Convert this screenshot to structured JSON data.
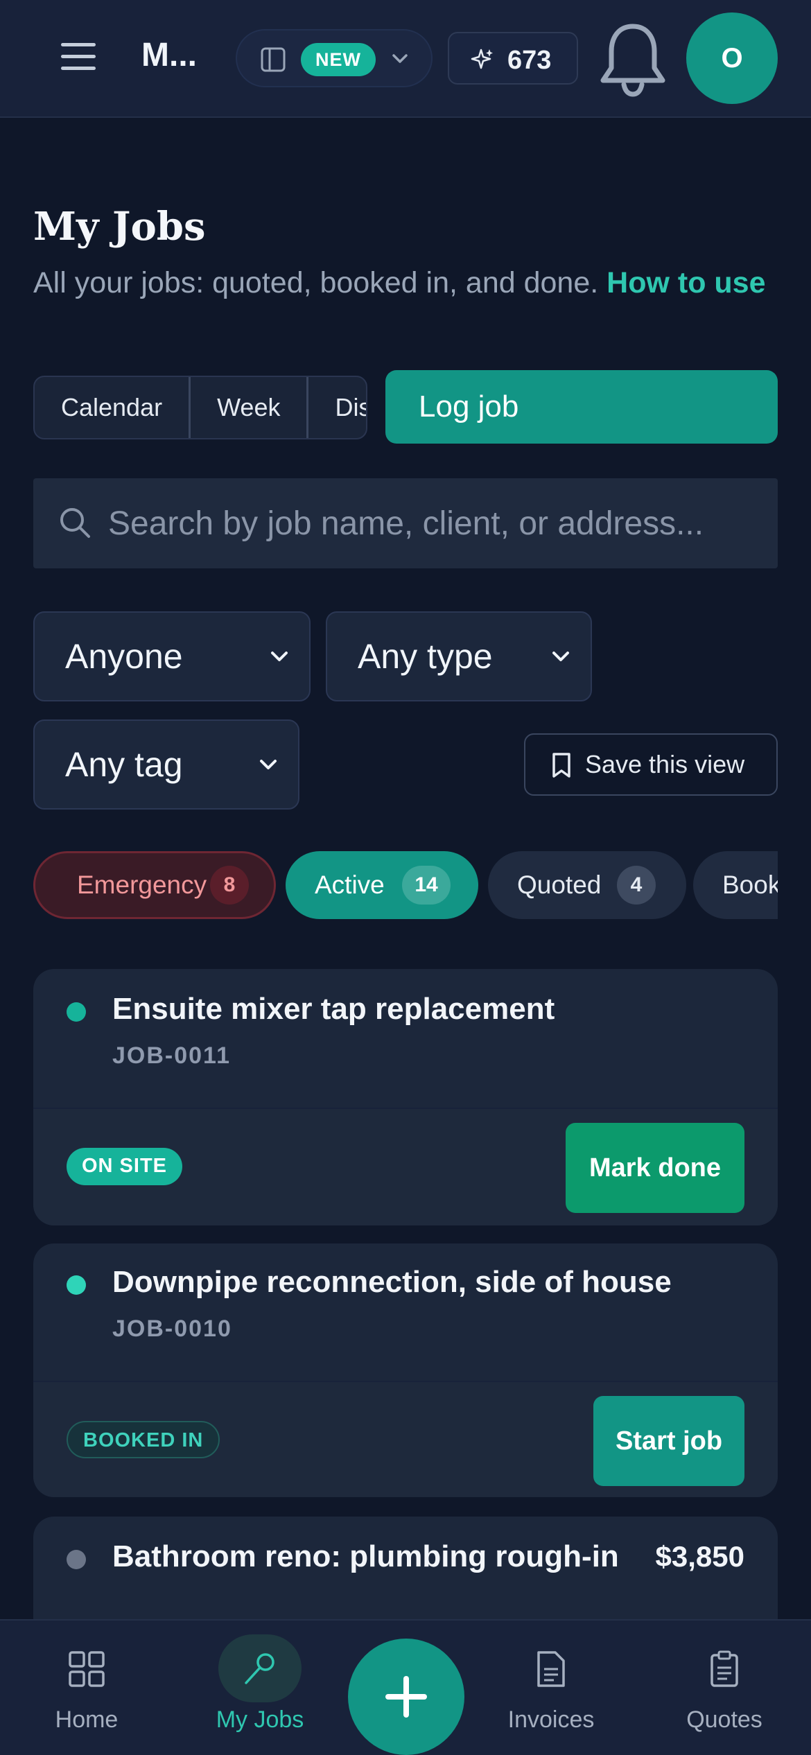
{
  "topbar": {
    "brand": "M...",
    "new_badge": "NEW",
    "credits": "673",
    "avatar_initial": "O"
  },
  "page": {
    "title": "My Jobs",
    "subtitle": "All your jobs: quoted, booked in, and done.",
    "how_to_link": "How to use"
  },
  "views": {
    "calendar": "Calendar",
    "week": "Week",
    "dispatch": "Dispatch",
    "log_job": "Log job"
  },
  "search": {
    "placeholder": "Search by job name, client, or address..."
  },
  "filters": {
    "assignee": "Anyone",
    "type": "Any type",
    "tag": "Any tag",
    "save_view": "Save this view"
  },
  "status_chips": [
    {
      "label": "Emergency",
      "count": "8"
    },
    {
      "label": "Active",
      "count": "14"
    },
    {
      "label": "Quoted",
      "count": "4"
    },
    {
      "label": "Booked in",
      "count": ""
    }
  ],
  "jobs": [
    {
      "title": "Ensuite mixer tap replacement",
      "code": "JOB-0011",
      "status": "ON SITE",
      "action": "Mark done",
      "dot_color": "#16b39a"
    },
    {
      "title": "Downpipe reconnection, side of house",
      "code": "JOB-0010",
      "status": "BOOKED IN",
      "action": "Start job",
      "dot_color": "#2fd4b8"
    },
    {
      "title": "Bathroom reno: plumbing rough-in",
      "price": "$3,850",
      "dot_color": "#6b7588"
    }
  ],
  "bottom_nav": {
    "home": "Home",
    "my_jobs": "My Jobs",
    "invoices": "Invoices",
    "quotes": "Quotes"
  },
  "colors": {
    "background": "#0f1729",
    "accent": "#129585",
    "emergency": "#f2989a",
    "done_green": "#0c9a6c"
  },
  "icons": {
    "menu": "hamburger-icon",
    "sidebar": "sidebar-panel-icon",
    "credits": "sparkle-icon",
    "notifications": "bell-icon",
    "search": "search-icon",
    "save_view": "bookmark-icon",
    "home": "grid-icon",
    "my_jobs": "wrench-icon",
    "invoices": "document-icon",
    "quotes": "clipboard-icon",
    "fab": "plus-icon"
  }
}
